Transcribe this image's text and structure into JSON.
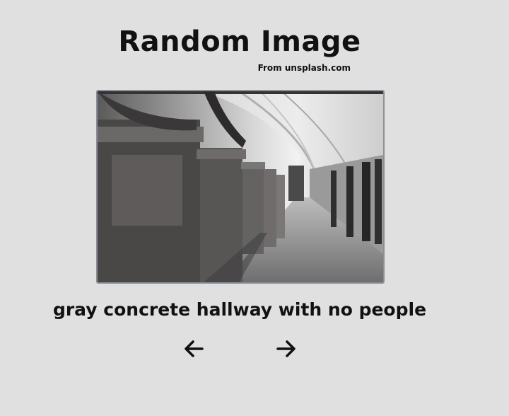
{
  "header": {
    "title": "Random Image",
    "subtitle": "From unsplash.com"
  },
  "image": {
    "alt": "gray concrete hallway with no people"
  },
  "caption": "gray concrete hallway with no people",
  "navigation": {
    "prev_icon": "arrow-left-icon",
    "next_icon": "arrow-right-icon"
  }
}
